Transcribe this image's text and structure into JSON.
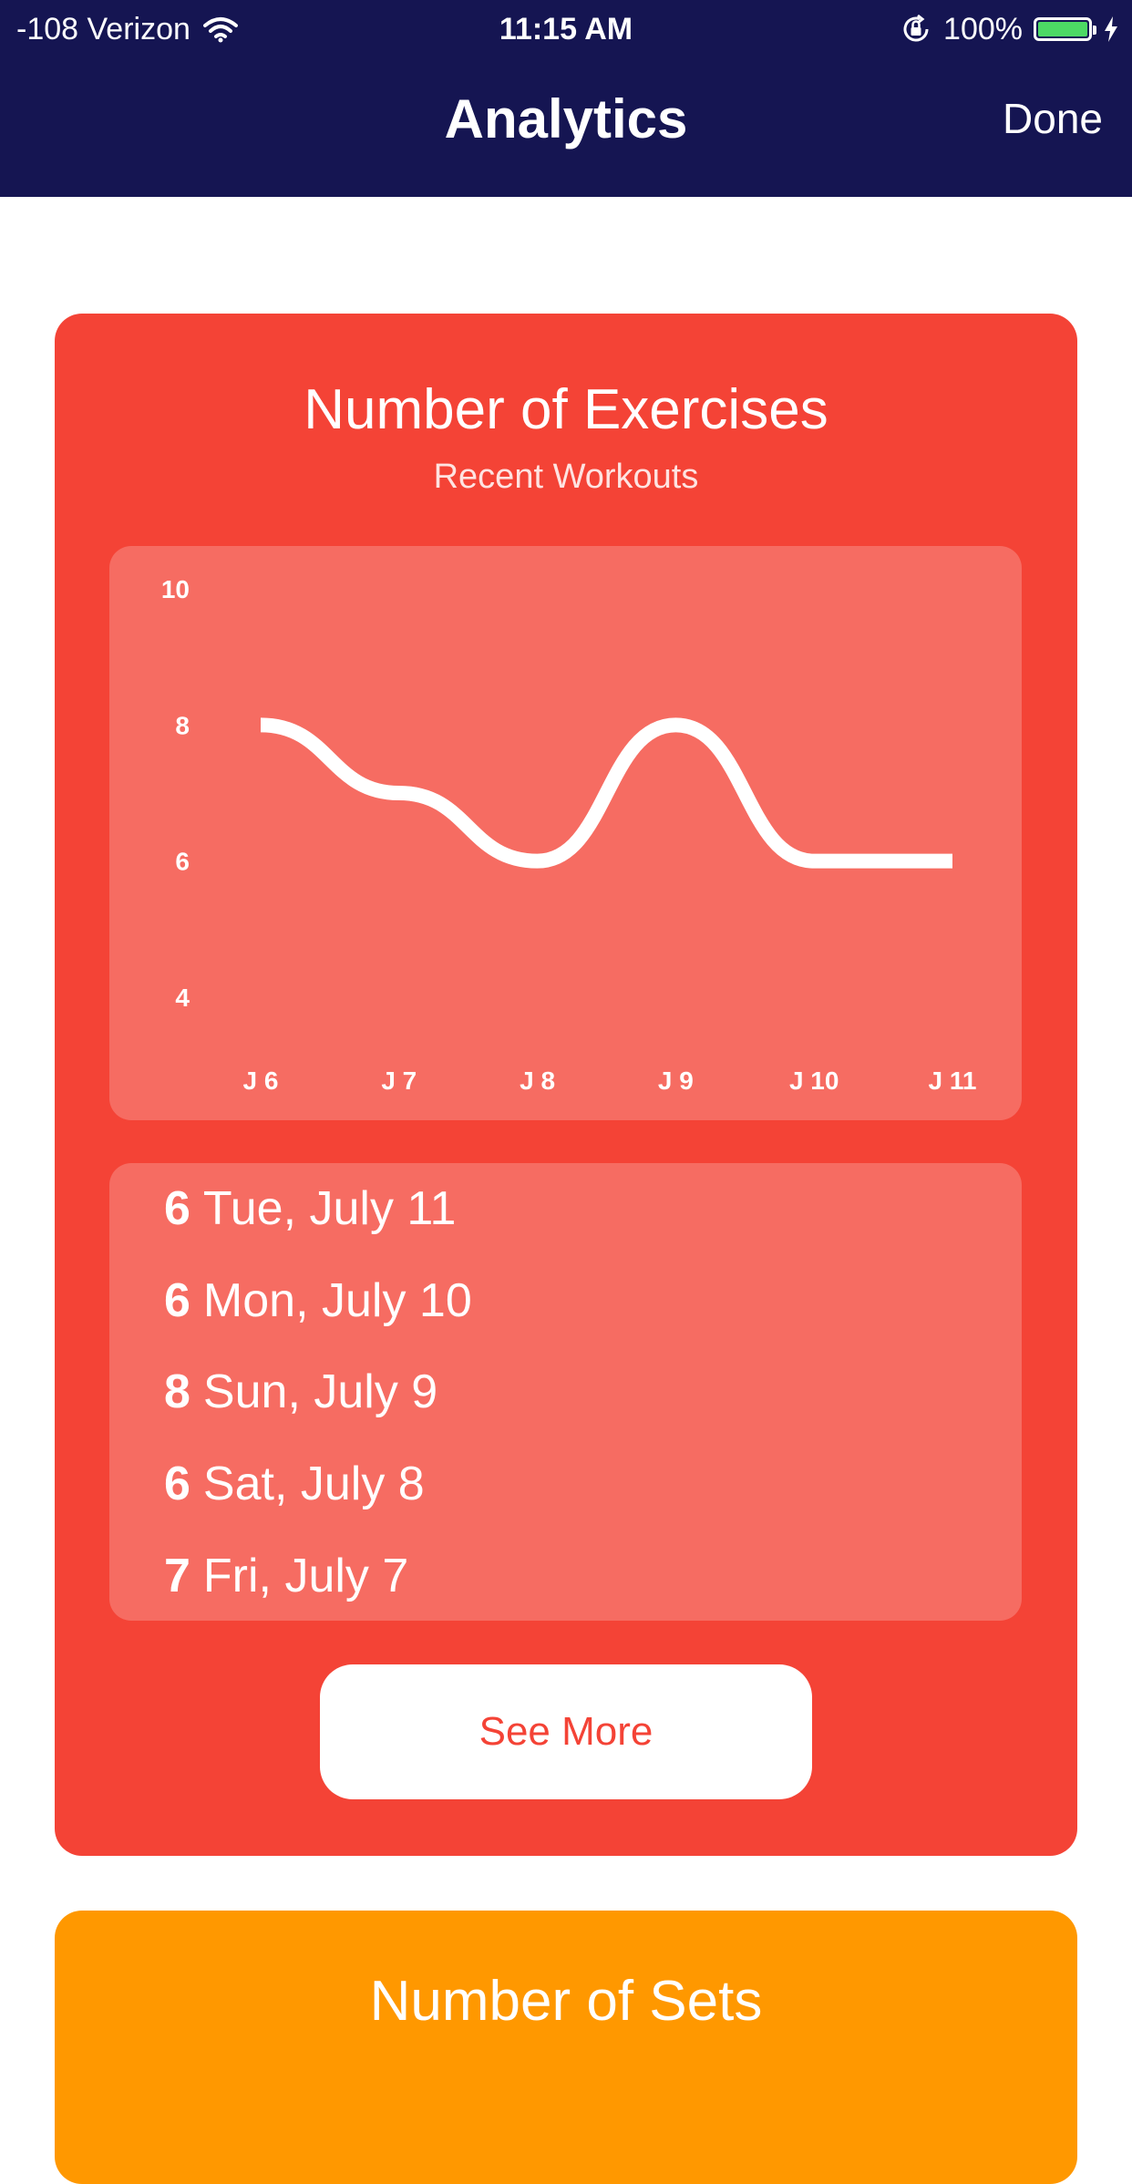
{
  "status_bar": {
    "carrier": "-108 Verizon",
    "time": "11:15 AM",
    "battery": "100%"
  },
  "nav": {
    "title": "Analytics",
    "done_label": "Done"
  },
  "cards": {
    "exercises": {
      "title": "Number of Exercises",
      "subtitle": "Recent Workouts",
      "see_more_label": "See More",
      "list": [
        {
          "value": "6",
          "date": "Tue, July 11"
        },
        {
          "value": "6",
          "date": "Mon, July 10"
        },
        {
          "value": "8",
          "date": "Sun, July 9"
        },
        {
          "value": "6",
          "date": "Sat, July 8"
        },
        {
          "value": "7",
          "date": "Fri, July 7"
        }
      ]
    },
    "sets": {
      "title": "Number of Sets"
    }
  },
  "chart_data": {
    "type": "line",
    "categories": [
      "J 6",
      "J 7",
      "J 8",
      "J 9",
      "J 10",
      "J 11"
    ],
    "values": [
      8,
      7,
      6,
      8,
      6,
      6
    ],
    "y_ticks": [
      "10",
      "8",
      "6",
      "4"
    ],
    "ylim": [
      4,
      10
    ],
    "title": "",
    "xlabel": "",
    "ylabel": "",
    "grid": false,
    "line_color": "#ffffff"
  },
  "colors": {
    "nav_bg": "#151552",
    "exercises_card": "#f44336",
    "sets_card": "#ff9800",
    "battery_fill": "#4cd964"
  }
}
